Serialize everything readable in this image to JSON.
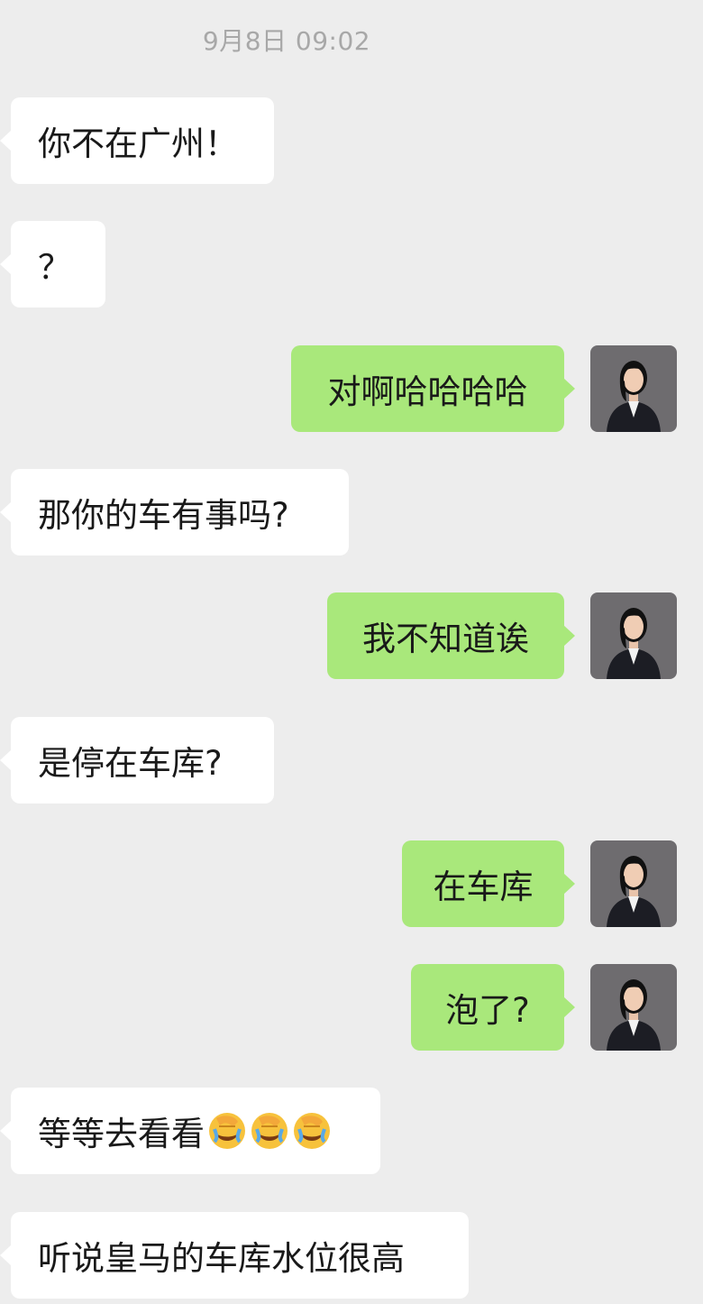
{
  "timestamp": "9月8日 09:02",
  "messages": [
    {
      "side": "in",
      "text": "你不在广州！"
    },
    {
      "side": "in",
      "text": "？"
    },
    {
      "side": "out",
      "text": "对啊哈哈哈哈"
    },
    {
      "side": "in",
      "text": "那你的车有事吗?"
    },
    {
      "side": "out",
      "text": "我不知道诶"
    },
    {
      "side": "in",
      "text": "是停在车库?"
    },
    {
      "side": "out",
      "text": "在车库"
    },
    {
      "side": "out",
      "text": "泡了?"
    },
    {
      "side": "in",
      "text": "等等去看看",
      "emoji": [
        "facepalm-crying-emoji",
        "facepalm-crying-emoji",
        "facepalm-crying-emoji"
      ]
    },
    {
      "side": "in",
      "text": "听说皇马的车库水位很高"
    }
  ],
  "avatar_icon": "user-avatar-photo",
  "colors": {
    "background": "#ededed",
    "incoming_bubble": "#ffffff",
    "outgoing_bubble": "#a9e87b",
    "timestamp_text": "#a8a8a8"
  }
}
